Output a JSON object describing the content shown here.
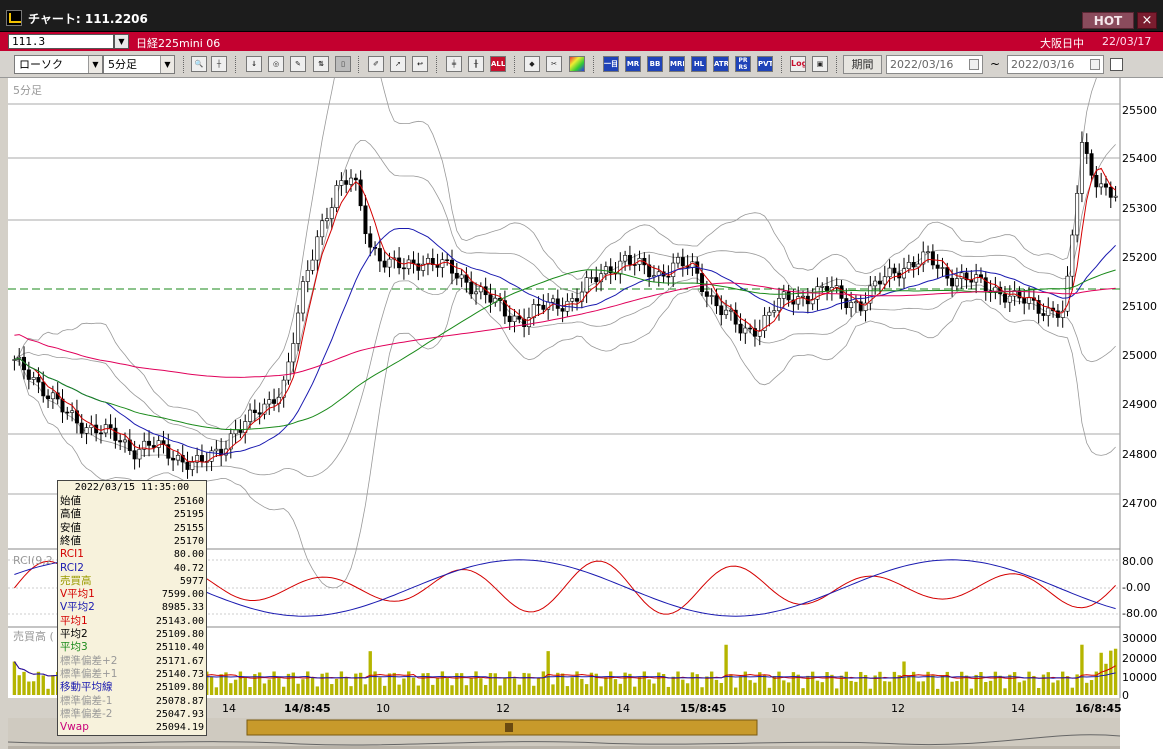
{
  "window": {
    "title": "チャート: 111.2206",
    "hot_label": "HOT",
    "close_label": "×"
  },
  "symbol_bar": {
    "code": "111.3",
    "name": "日経225mini 06",
    "session": "大阪日中",
    "date": "22/03/17"
  },
  "toolbar": {
    "chart_type": "ローソク",
    "interval": "5分足",
    "period_label": "期間",
    "date_from": "2022/03/16",
    "date_to": "2022/03/16",
    "tilde": "~",
    "buttons": [
      "zoom-icon",
      "crosshair-icon",
      "draw-icon",
      "chart-icon",
      "tool-icon",
      "chart2-icon",
      "pen-icon",
      "cursor-icon",
      "arrow-icon",
      "candle-icon",
      "ohlc-icon",
      "all-icon",
      "paint-icon",
      "wrench-icon",
      "color-icon",
      "ichimoku-icon",
      "mr-icon",
      "bb-icon",
      "mre-icon",
      "hl-icon",
      "atr-icon",
      "pr-icon",
      "pvt-icon",
      "log-icon",
      "print-icon"
    ],
    "button_labels": {
      "all": "ALL",
      "mr": "MR",
      "bb": "BB",
      "mre": "MRE",
      "hl": "HL",
      "atr": "ATR",
      "pr": "PR\nRS",
      "pvt": "PVT",
      "log": "Log"
    }
  },
  "panes": {
    "price_title": "5分足",
    "rci_title": "RCI(9,2",
    "volume_title": "売買高 ("
  },
  "price_axis": [
    "25500",
    "25400",
    "25300",
    "25200",
    "25100",
    "25000",
    "24900",
    "24800",
    "24700"
  ],
  "rci_axis": [
    "80.00",
    "-0.00",
    "-80.00"
  ],
  "volume_axis": [
    "30000",
    "20000",
    "10000",
    "0"
  ],
  "time_axis": [
    "14",
    "14/8:45",
    "10",
    "12",
    "14",
    "15/8:45",
    "10",
    "12",
    "14",
    "16/8:45"
  ],
  "info_panel": {
    "header": "2022/03/15 11:35:00",
    "rows": [
      {
        "k": "始値",
        "v": "25160",
        "color": "#000000"
      },
      {
        "k": "高値",
        "v": "25195",
        "color": "#000000"
      },
      {
        "k": "安値",
        "v": "25155",
        "color": "#000000"
      },
      {
        "k": "終値",
        "v": "25170",
        "color": "#000000"
      },
      {
        "k": "RCI1",
        "v": "80.00",
        "color": "#d40000"
      },
      {
        "k": "RCI2",
        "v": "40.72",
        "color": "#1a1ab0"
      },
      {
        "k": "売買高",
        "v": "5977",
        "color": "#9a9a00"
      },
      {
        "k": "V平均1",
        "v": "7599.00",
        "color": "#d40000"
      },
      {
        "k": "V平均2",
        "v": "8985.33",
        "color": "#1a1ab0"
      },
      {
        "k": "平均1",
        "v": "25143.00",
        "color": "#d40000"
      },
      {
        "k": "平均2",
        "v": "25109.80",
        "color": "#000000"
      },
      {
        "k": "平均3",
        "v": "25110.40",
        "color": "#1a8a1a"
      },
      {
        "k": "標準偏差+2",
        "v": "25171.67",
        "color": "#999999"
      },
      {
        "k": "標準偏差+1",
        "v": "25140.73",
        "color": "#999999"
      },
      {
        "k": "移動平均線",
        "v": "25109.80",
        "color": "#1a1ab0"
      },
      {
        "k": "標準偏差-1",
        "v": "25078.87",
        "color": "#999999"
      },
      {
        "k": "標準偏差-2",
        "v": "25047.93",
        "color": "#999999"
      },
      {
        "k": "Vwap",
        "v": "25094.19",
        "color": "#c8007a"
      }
    ]
  },
  "chart_data": {
    "type": "candlestick",
    "interval": "5分足",
    "ylim": [
      24650,
      25550
    ],
    "ohlc_path_close": [
      24980,
      24960,
      24920,
      24880,
      24860,
      24850,
      24830,
      24810,
      24820,
      24800,
      24790,
      24780,
      24800,
      24850,
      24870,
      24900,
      24950,
      25120,
      25250,
      25330,
      25350,
      25220,
      25180,
      25170,
      25190,
      25180,
      25160,
      25140,
      25110,
      25080,
      25070,
      25090,
      25100,
      25110,
      25140,
      25170,
      25190,
      25170,
      25160,
      25180,
      25170,
      25120,
      25080,
      25040,
      25060,
      25100,
      25110,
      25120,
      25130,
      25110,
      25100,
      25140,
      25170,
      25180,
      25190,
      25160,
      25150,
      25140,
      25130,
      25110,
      25100,
      25090,
      25080,
      25420,
      25340,
      25310
    ],
    "series_colors": {
      "candle_up": "#ffffff",
      "candle_down": "#000000",
      "ma_short": "#d40000",
      "ma_mid": "#1a1ab0",
      "ma_long": "#1a8a1a",
      "vwap": "#e0005a",
      "bollinger": "#999999",
      "volume_bar": "#b5b500",
      "dashed_level": "#1a8a1a"
    },
    "dashed_level": 25130,
    "rci": {
      "rci1_color": "#d40000",
      "rci2_color": "#1a1ab0"
    },
    "volume_max": 30000
  }
}
